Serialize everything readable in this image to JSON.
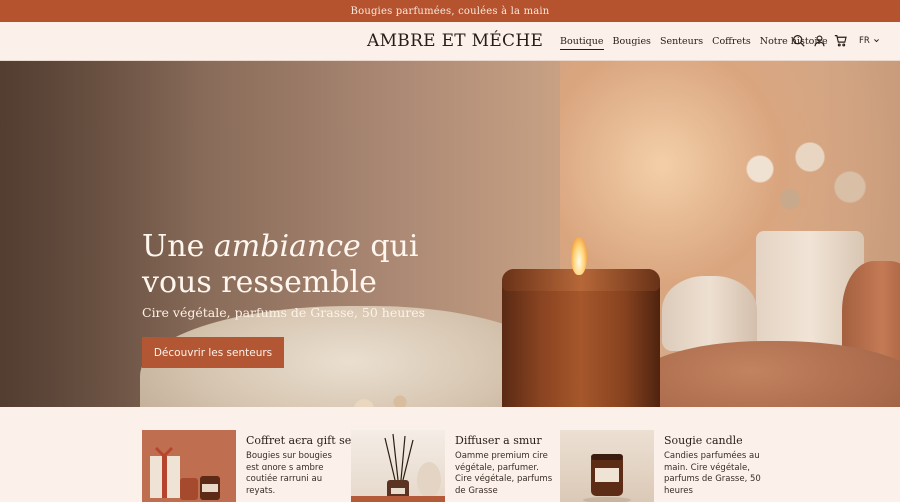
{
  "announcement": "Bougies parfumées, coulées à la main",
  "header": {
    "logo": "AMBRE ET MÉCHE",
    "nav": [
      "Boutique",
      "Bougies",
      "Senteurs",
      "Coffrets",
      "Notre histoire"
    ],
    "active_nav": "Boutique",
    "icons": [
      "search-icon",
      "user-icon",
      "cart-icon"
    ],
    "language": "FR"
  },
  "hero": {
    "title_line1_start": "Une ",
    "title_line1_em": "ambiance",
    "title_line1_end": " qui",
    "title_line2": "vous ressemble",
    "subtitle": "Cire végétale, parfums de Grasse, 50 heures",
    "cta": "Découvrir les senteurs"
  },
  "products": [
    {
      "title": "Coffret aєrа gift set",
      "description": "Bougies sur bougies est ɑnore s ambre coutiée rarruni au reyats."
    },
    {
      "title": "Diffuser a smur",
      "description": "Oamme premium cire végétale, parfumer. Cire végétale, parfums de Grasse"
    },
    {
      "title": "Sougie candle",
      "description": "Candies parfumées au main. Cire végétale, parfums de Grasse, 50 heures"
    }
  ],
  "colors": {
    "accent": "#b25634",
    "announce_bg": "#b6532f",
    "page_bg": "#fbf1ea"
  }
}
